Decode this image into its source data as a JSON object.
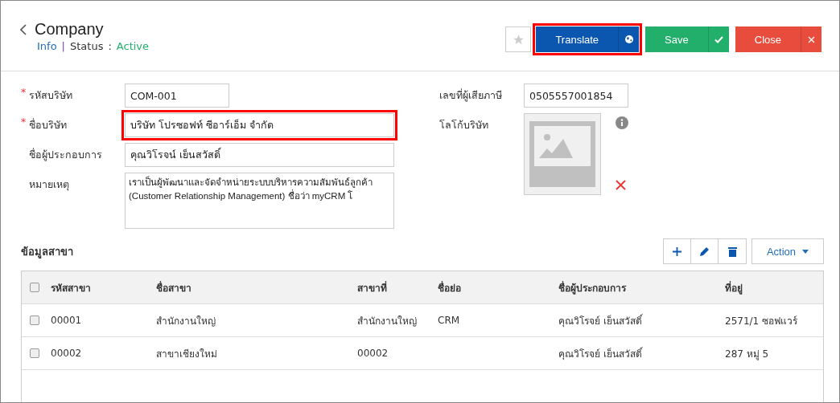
{
  "header": {
    "title": "Company",
    "info_link": "Info",
    "divider": "|",
    "status_label": "Status",
    "status_separator": ":",
    "status_value": "Active"
  },
  "toolbar": {
    "favorite": {
      "selected": false
    },
    "buttons": [
      {
        "kind": "translate",
        "label": "Translate",
        "highlighted": true
      },
      {
        "kind": "save",
        "label": "Save",
        "highlighted": false
      },
      {
        "kind": "close",
        "label": "Close",
        "highlighted": false
      }
    ]
  },
  "required_mark": "*",
  "form_left": [
    {
      "kind": "short",
      "label": "รหัสบริษัท",
      "required": true,
      "value": "COM-001",
      "highlighted": false
    },
    {
      "kind": "wide",
      "label": "ชื่อบริษัท",
      "required": true,
      "value": "บริษัท โปรซอฟท์ ซีอาร์เอ็ม จำกัด",
      "highlighted": true
    },
    {
      "kind": "wide",
      "label": "ชื่อผู้ประกอบการ",
      "required": false,
      "value": "คุณวิโรจน์ เย็นสวัสดิ์",
      "highlighted": false
    },
    {
      "kind": "textarea",
      "label": "หมายเหตุ",
      "value": "เราเป็นผู้พัฒนาและจัดจำหน่ายระบบบริหารความสัมพันธ์ลูกค้า\n(Customer Relationship Management) ชื่อว่า myCRM โ"
    }
  ],
  "form_right": {
    "tax_label": "เลขที่ผู้เสียภาษี",
    "tax_value": "0505557001854",
    "logo_label": "โลโก้บริษัท"
  },
  "branches": {
    "title": "ข้อมูลสาขา",
    "action_label": "Action",
    "columns": [
      "รหัสสาขา",
      "ชื่อสาขา",
      "สาขาที่",
      "ชื่อย่อ",
      "ชื่อผู้ประกอบการ",
      "ที่อยู่"
    ],
    "all_checked": false,
    "rows": [
      {
        "checked": false,
        "cells": [
          "00001",
          "สำนักงานใหญ่",
          "สำนักงานใหญ่",
          "CRM",
          "คุณวิโรจย์ เย็นสวัสดิ์",
          "2571/1 ซอฟแวร์"
        ]
      },
      {
        "checked": false,
        "cells": [
          "00002",
          "สาขาเชียงใหม่",
          "00002",
          "",
          "คุณวิโรจย์ เย็นสวัสดิ์",
          "287 หมู่ 5"
        ]
      }
    ]
  }
}
